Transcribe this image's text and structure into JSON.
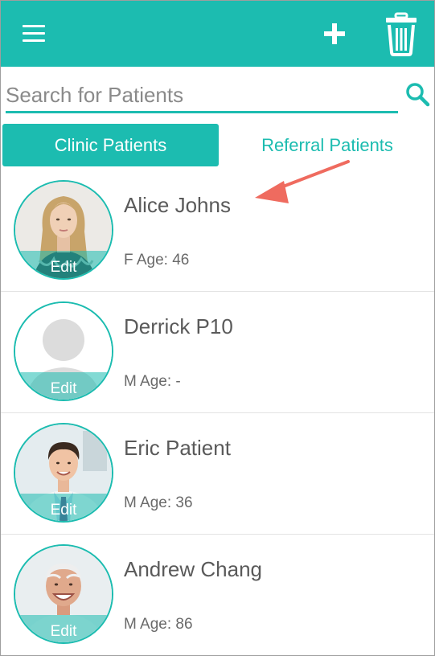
{
  "header": {
    "menu_icon": "hamburger-menu-icon",
    "add_icon": "plus-icon",
    "delete_icon": "trash-icon",
    "bar_color": "#1cbcb0"
  },
  "search": {
    "placeholder": "Search for Patients",
    "value": "",
    "icon": "search-icon"
  },
  "tabs": [
    {
      "label": "Clinic Patients",
      "active": true
    },
    {
      "label": "Referral Patients",
      "active": false
    }
  ],
  "annotation": {
    "icon": "red-arrow-icon",
    "color": "#ef6b5f"
  },
  "patients": [
    {
      "name": "Alice Johns",
      "meta": "F Age: 46",
      "edit_label": "Edit",
      "avatar": "photo-woman-blonde"
    },
    {
      "name": "Derrick P10",
      "meta": "M Age: -",
      "edit_label": "Edit",
      "avatar": "placeholder-silhouette"
    },
    {
      "name": "Eric Patient",
      "meta": "M Age: 36",
      "edit_label": "Edit",
      "avatar": "photo-man-doctor"
    },
    {
      "name": "Andrew Chang",
      "meta": "M Age: 86",
      "edit_label": "Edit",
      "avatar": "photo-elderly-man"
    }
  ]
}
